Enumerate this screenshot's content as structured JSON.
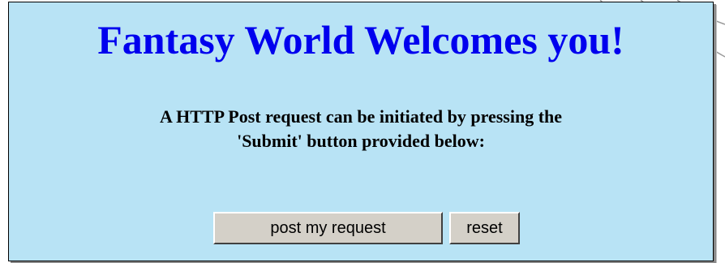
{
  "page": {
    "title": "Fantasy World Welcomes you!",
    "message_line1": "A HTTP Post request can be initiated by pressing the",
    "message_line2": "'Submit' button provided below:"
  },
  "form": {
    "submit_label": "post my request",
    "reset_label": "reset"
  },
  "colors": {
    "panel_background": "#b8e3f5",
    "title_color": "#0000ee",
    "button_face": "#d4d0c8"
  }
}
